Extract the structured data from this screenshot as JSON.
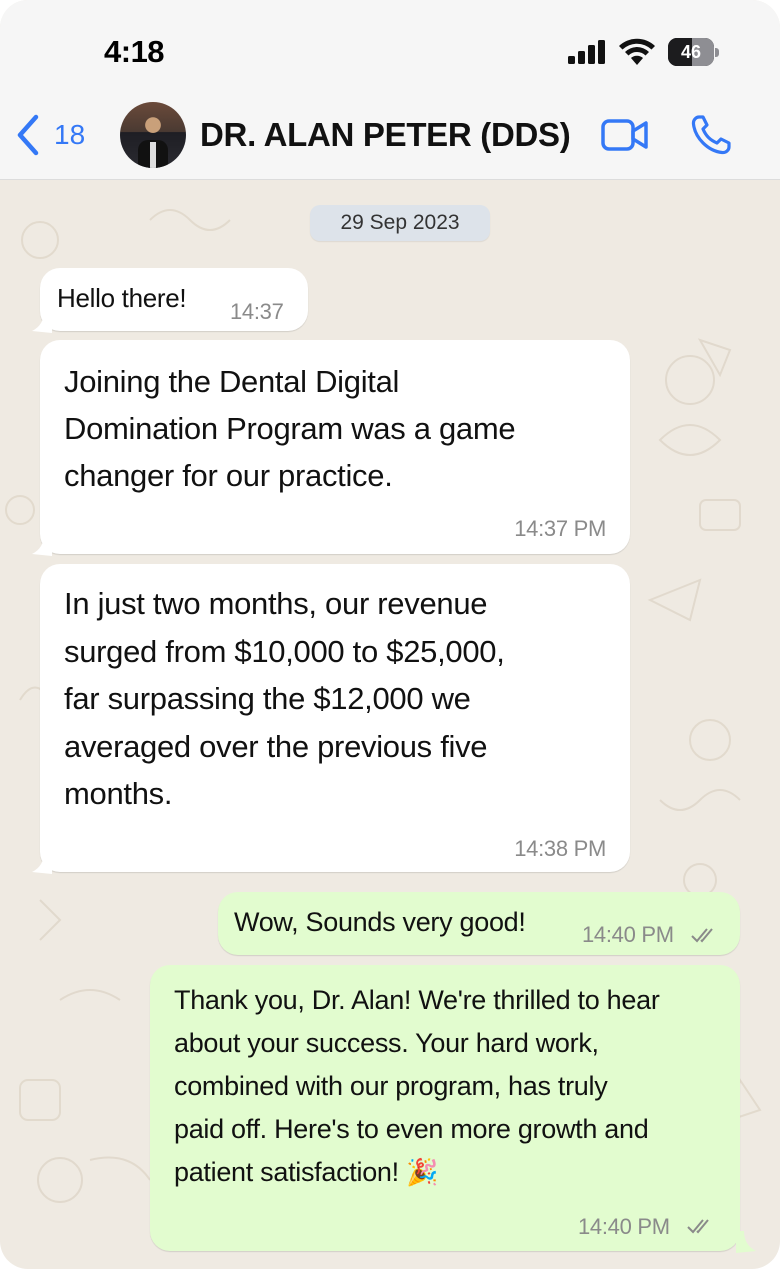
{
  "status_bar": {
    "time": "4:18",
    "battery_level": "46"
  },
  "header": {
    "back_count": "18",
    "contact_name": "DR. ALAN PETER (DDS)",
    "accent_color": "#3478f6"
  },
  "chat": {
    "date_chip": "29 Sep 2023",
    "messages": [
      {
        "direction": "incoming",
        "text": "Hello there!",
        "time": "14:37"
      },
      {
        "direction": "incoming",
        "text": "Joining the Dental Digital\nDomination Program was a game\nchanger for our practice.",
        "time": "14:37 PM"
      },
      {
        "direction": "incoming",
        "text": "In just two months, our revenue\nsurged from $10,000 to $25,000,\nfar surpassing the $12,000 we\naveraged over the previous five\nmonths.",
        "time": "14:38 PM"
      },
      {
        "direction": "outgoing",
        "text": "Wow, Sounds very good!",
        "time": "14:40 PM",
        "status": "read"
      },
      {
        "direction": "outgoing",
        "text": "Thank you, Dr. Alan! We're thrilled to hear\nabout your success. Your hard work,\ncombined with our program, has truly\npaid off. Here's to even more growth and\npatient satisfaction! ",
        "emoji": "🎉",
        "time": "14:40 PM",
        "status": "read"
      }
    ]
  },
  "colors": {
    "incoming_bubble": "#ffffff",
    "outgoing_bubble": "#e2fccf",
    "chat_background": "#efeae2"
  }
}
